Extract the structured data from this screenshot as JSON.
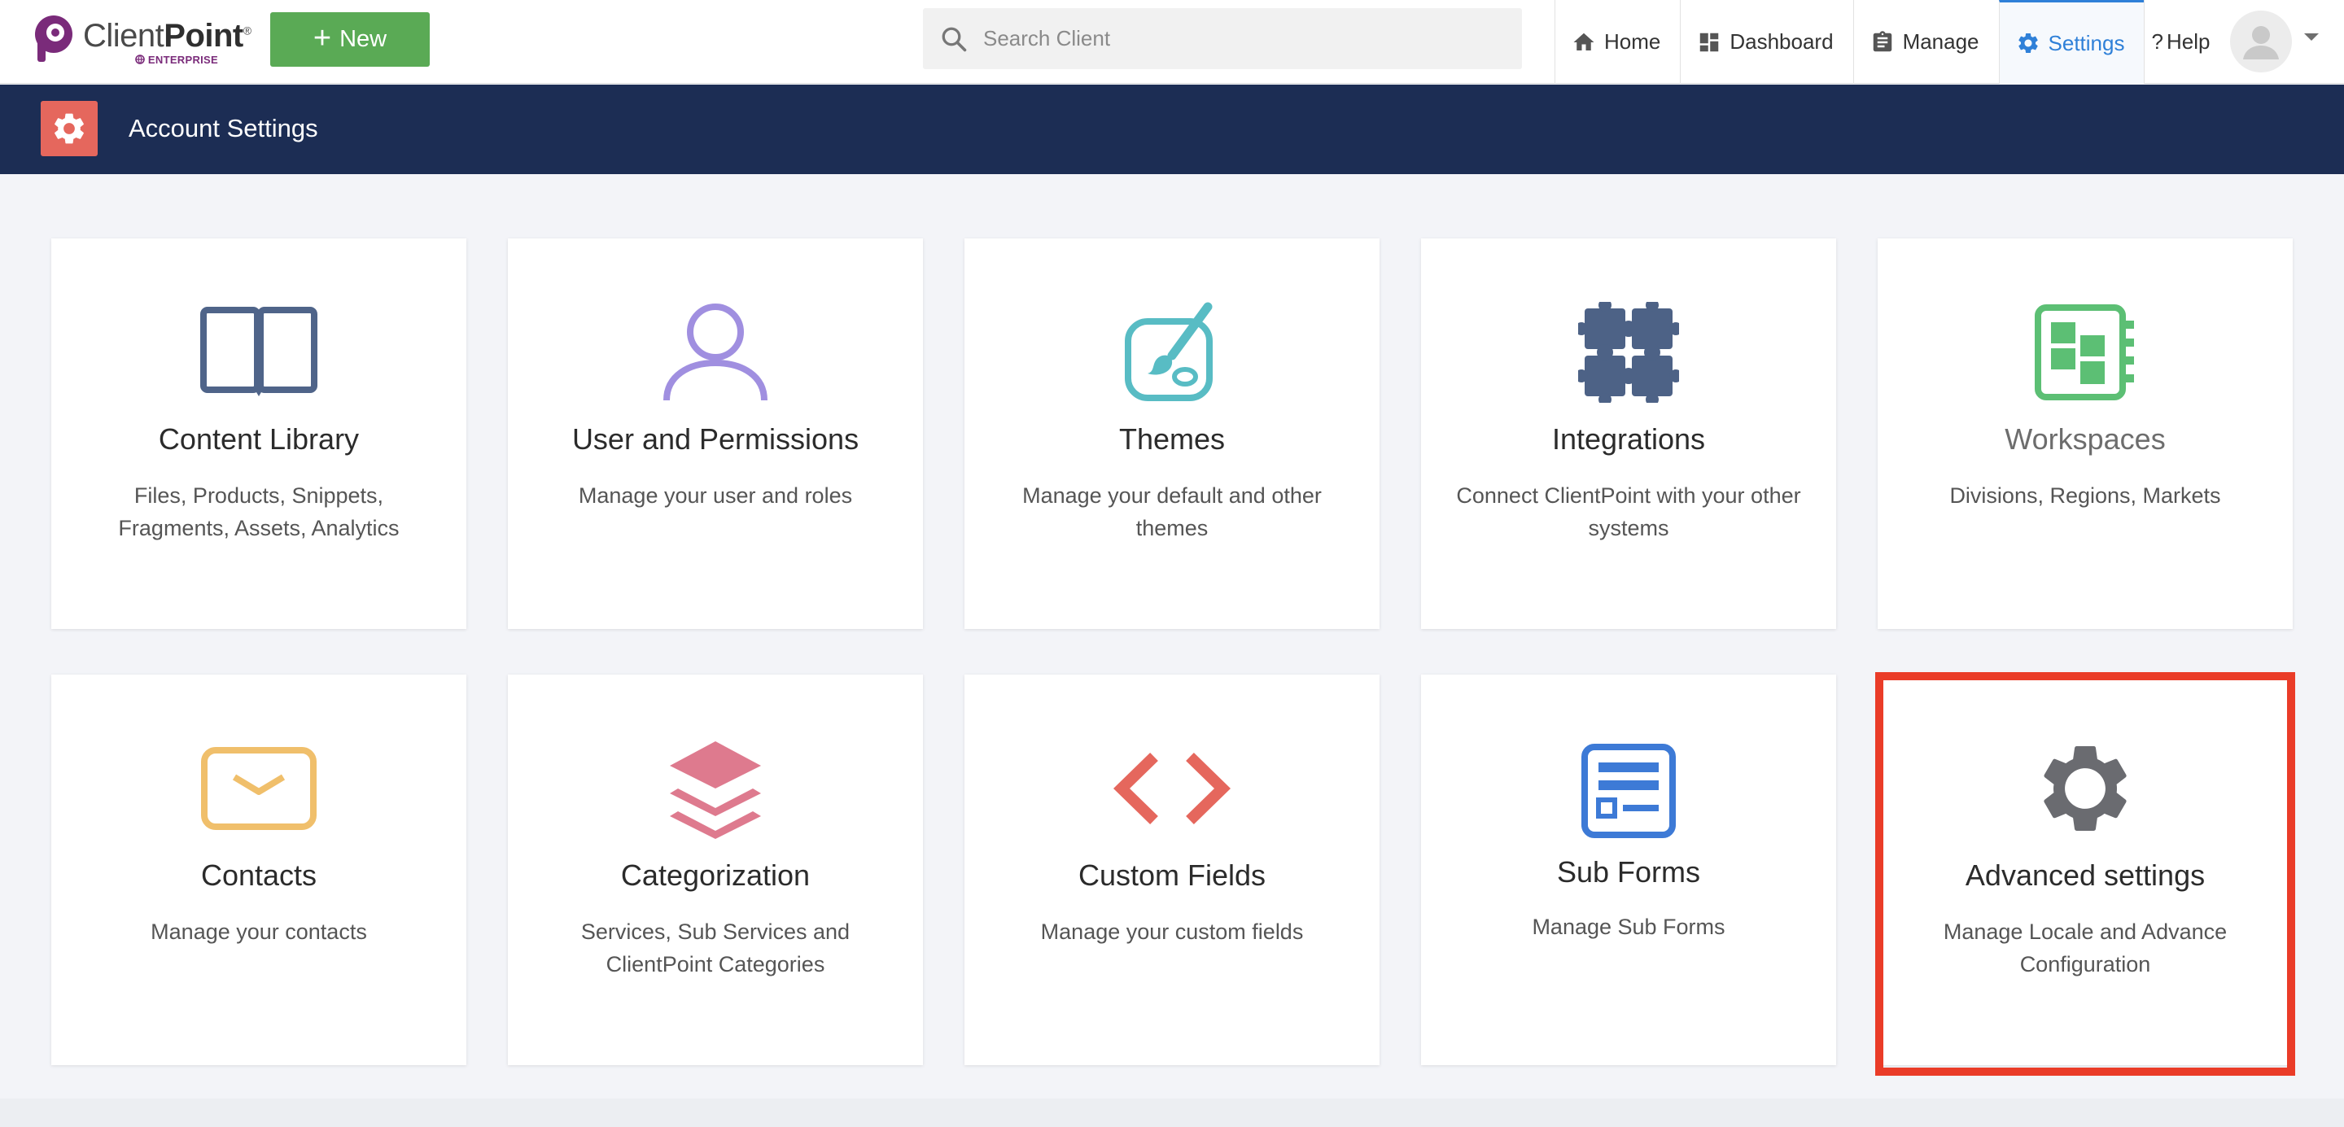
{
  "brand": {
    "name_light": "Client",
    "name_bold": "Point",
    "registered": "®",
    "edition": "ENTERPRISE",
    "color": "#7a2b7a"
  },
  "toolbar": {
    "new_label": "New",
    "new_color": "#5aaa55"
  },
  "search": {
    "placeholder": "Search Client"
  },
  "nav": {
    "home": "Home",
    "dashboard": "Dashboard",
    "manage": "Manage",
    "settings": "Settings",
    "help": "Help",
    "active": "Settings",
    "active_color": "#2f80d8"
  },
  "header": {
    "title": "Account Settings",
    "background": "#1c2d54",
    "icon_color": "#e5675d"
  },
  "cards": [
    {
      "icon": "book-icon",
      "title": "Content Library",
      "description": "Files, Products, Snippets, Fragments, Assets, Analytics",
      "color": "#4f6489"
    },
    {
      "icon": "user-icon",
      "title": "User and Permissions",
      "description": "Manage your user and roles",
      "color": "#a08fe0"
    },
    {
      "icon": "palette-icon",
      "title": "Themes",
      "description": "Manage your default and other themes",
      "color": "#58bcc4"
    },
    {
      "icon": "puzzle-icon",
      "title": "Integrations",
      "description": "Connect ClientPoint with your other systems",
      "color": "#4d6286"
    },
    {
      "icon": "workspace-icon",
      "title": "Workspaces",
      "description": "Divisions, Regions, Markets",
      "color": "#5cbf74"
    },
    {
      "icon": "envelope-icon",
      "title": "Contacts",
      "description": "Manage your contacts",
      "color": "#f0bf6b"
    },
    {
      "icon": "layers-icon",
      "title": "Categorization",
      "description": "Services, Sub Services and ClientPoint Categories",
      "color": "#de7a8e"
    },
    {
      "icon": "code-icon",
      "title": "Custom Fields",
      "description": "Manage your custom fields",
      "color": "#e5675d"
    },
    {
      "icon": "form-icon",
      "title": "Sub Forms",
      "description": "Manage Sub Forms",
      "color": "#3d7ad6"
    },
    {
      "icon": "gear-icon",
      "title": "Advanced settings",
      "description": "Manage Locale and Advance Configuration",
      "color": "#6a6b70"
    }
  ],
  "highlighted_card": "Advanced settings",
  "highlight_color": "#ea3c28"
}
